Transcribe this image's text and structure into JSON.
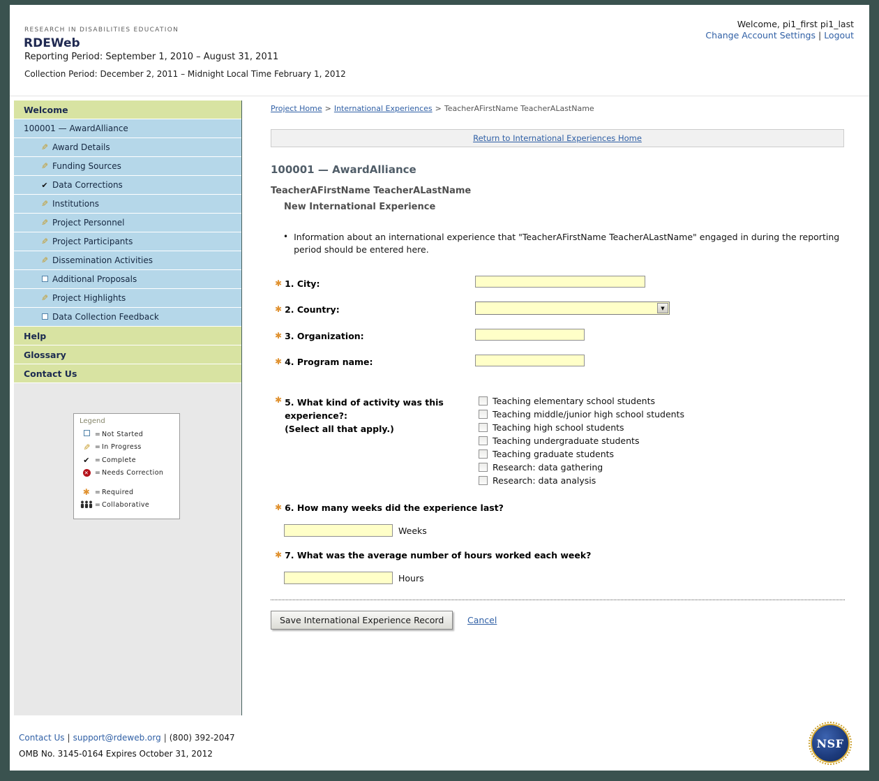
{
  "colors": {
    "frame": "#3a524f",
    "nav_green": "#d8e3a2",
    "nav_blue": "#b5d7e9",
    "field_yellow": "#ffffc8",
    "required_orange": "#e0912f",
    "link_blue": "#2f5fa5"
  },
  "icons": {
    "pencil": "✎",
    "check": "✔",
    "error_x": "✕",
    "required": "✱",
    "dropdown_arrow": "▼",
    "bullet": "•"
  },
  "header": {
    "org_name": "RESEARCH IN DISABILITIES EDUCATION",
    "app_name": "RDEWeb",
    "reporting_period": "Reporting Period: September 1, 2010 – August 31, 2011",
    "collection_period": "Collection Period: December 2, 2011 – Midnight Local Time February 1, 2012",
    "welcome_text": "Welcome, pi1_first pi1_last",
    "change_account": "Change Account Settings",
    "separator": "|",
    "logout": "Logout"
  },
  "sidebar": {
    "sections": {
      "welcome": "Welcome",
      "help": "Help",
      "glossary": "Glossary",
      "contact": "Contact Us"
    },
    "award": "100001 — AwardAlliance",
    "items": [
      {
        "label": "Award Details",
        "status": "in-progress"
      },
      {
        "label": "Funding Sources",
        "status": "in-progress"
      },
      {
        "label": "Data Corrections",
        "status": "complete"
      },
      {
        "label": "Institutions",
        "status": "in-progress"
      },
      {
        "label": "Project Personnel",
        "status": "in-progress"
      },
      {
        "label": "Project Participants",
        "status": "in-progress"
      },
      {
        "label": "Dissemination Activities",
        "status": "in-progress"
      },
      {
        "label": "Additional Proposals",
        "status": "not-started"
      },
      {
        "label": "Project Highlights",
        "status": "in-progress"
      },
      {
        "label": "Data Collection Feedback",
        "status": "not-started"
      }
    ],
    "legend": {
      "title": "Legend",
      "equals": "=",
      "rows": [
        {
          "icon": "square",
          "label": "Not Started"
        },
        {
          "icon": "pencil",
          "label": "In Progress"
        },
        {
          "icon": "check",
          "label": "Complete"
        },
        {
          "icon": "error",
          "label": "Needs Correction"
        },
        {
          "icon": "asterisk",
          "label": "Required"
        },
        {
          "icon": "people",
          "label": "Collaborative"
        }
      ]
    }
  },
  "breadcrumb": {
    "project_home": "Project Home",
    "sep": ">",
    "international_experiences": "International Experiences",
    "current": "TeacherAFirstName TeacherALastName"
  },
  "main": {
    "return_link": "Return to International Experiences Home",
    "award_title": "100001 — AwardAlliance",
    "teacher_name": "TeacherAFirstName TeacherALastName",
    "page_subtitle": "New International Experience",
    "info_text": "Information about an international experience that \"TeacherAFirstName TeacherALastName\" engaged in during the reporting period should be entered here.",
    "form": {
      "city": {
        "label": "1. City:",
        "value": ""
      },
      "country": {
        "label": "2. Country:",
        "value": ""
      },
      "organization": {
        "label": "3. Organization:",
        "value": ""
      },
      "program": {
        "label": "4. Program name:",
        "value": ""
      },
      "activity": {
        "label": "5. What kind of activity was this experience?:",
        "hint": "(Select all that apply.)",
        "options": [
          {
            "label": "Teaching elementary school students",
            "checked": false
          },
          {
            "label": "Teaching middle/junior high school students",
            "checked": false
          },
          {
            "label": "Teaching high school students",
            "checked": false
          },
          {
            "label": "Teaching undergraduate students",
            "checked": false
          },
          {
            "label": "Teaching graduate students",
            "checked": false
          },
          {
            "label": "Research: data gathering",
            "checked": false
          },
          {
            "label": "Research: data analysis",
            "checked": false
          }
        ]
      },
      "weeks": {
        "label": "6. How many weeks did the experience last?",
        "unit": "Weeks",
        "value": ""
      },
      "hours": {
        "label": "7. What was the average number of hours worked each week?",
        "unit": "Hours",
        "value": ""
      }
    },
    "save_button": "Save International Experience Record",
    "cancel_link": "Cancel"
  },
  "footer": {
    "contact_link": "Contact Us",
    "separator": "|",
    "email_link": "support@rdeweb.org",
    "phone": "(800) 392-2047",
    "omb_text": "OMB No. 3145-0164 Expires October 31, 2012",
    "nsf_text": "NSF"
  }
}
